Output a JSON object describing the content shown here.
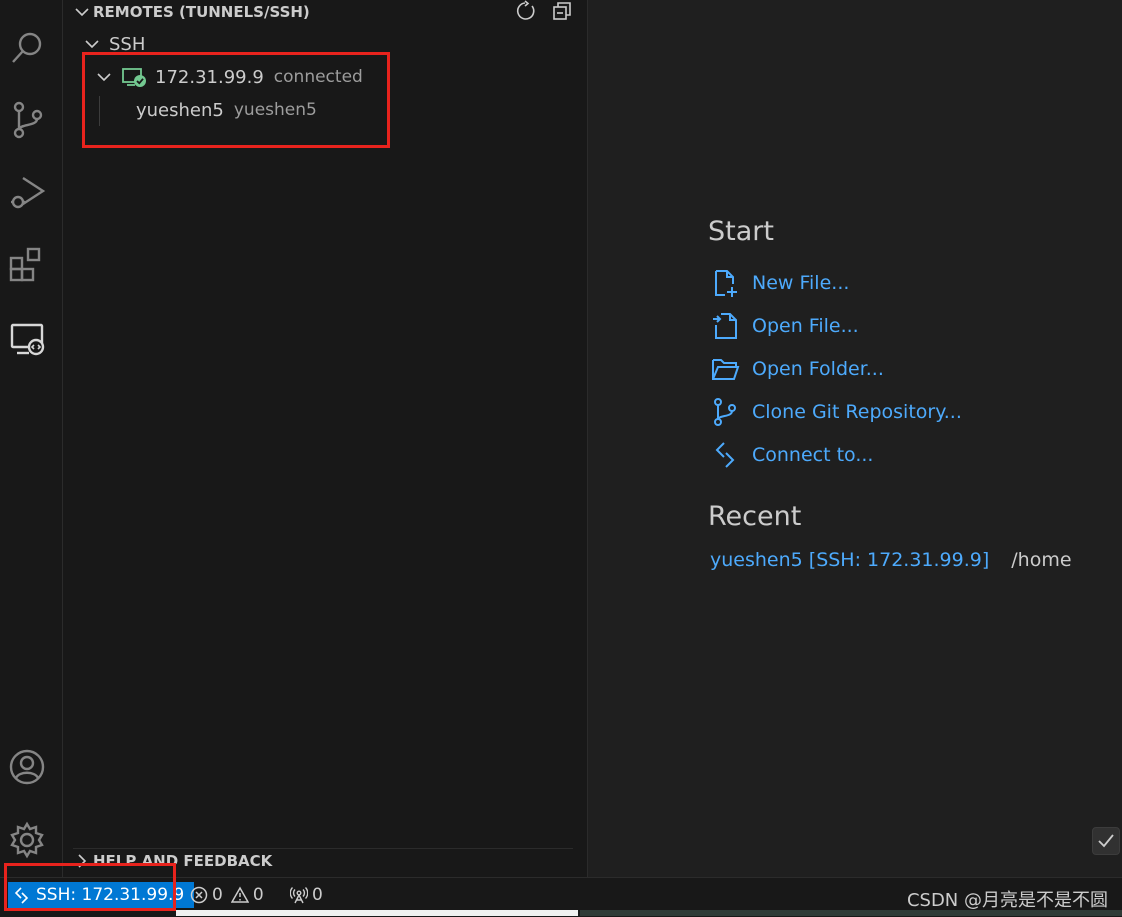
{
  "sidebar": {
    "section_title": "REMOTES (TUNNELS/SSH)",
    "group_label": "SSH",
    "host": {
      "name": "172.31.99.9",
      "status": "connected"
    },
    "folder": {
      "name": "yueshen5",
      "path": "yueshen5"
    },
    "help_title": "HELP AND FEEDBACK"
  },
  "editor": {
    "start_heading": "Start",
    "start_items": [
      {
        "label": "New File...",
        "icon": "new-file-icon"
      },
      {
        "label": "Open File...",
        "icon": "open-file-icon"
      },
      {
        "label": "Open Folder...",
        "icon": "open-folder-icon"
      },
      {
        "label": "Clone Git Repository...",
        "icon": "source-control-icon"
      },
      {
        "label": "Connect to...",
        "icon": "remote-icon"
      }
    ],
    "recent_heading": "Recent",
    "recent": [
      {
        "name": "yueshen5 [SSH: 172.31.99.9]",
        "path": "/home"
      }
    ]
  },
  "statusbar": {
    "remote": "SSH: 172.31.99.9",
    "errors": "0",
    "warnings": "0",
    "ports": "0",
    "watermark": "CSDN @月亮是不是不圆"
  },
  "colors": {
    "accent": "#0078d4",
    "link": "#4daafc",
    "connected": "#73c991",
    "highlight": "#e8231d"
  }
}
